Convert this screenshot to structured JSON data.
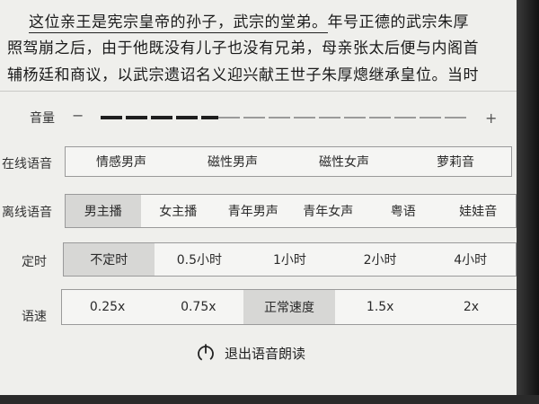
{
  "reading_text": {
    "line1_underlined": "这位亲王是宪宗皇帝的孙子，武宗的堂弟。",
    "line1_rest": "年号正德的武宗朱厚",
    "line2": "照驾崩之后，由于他既没有儿子也没有兄弟，母亲张太后便与内阁首",
    "line3": "辅杨廷和商议，以武宗遗诏名义迎兴献王世子朱厚熜继承皇位。当时"
  },
  "volume": {
    "label": "音量",
    "minus": "−",
    "plus": "+",
    "level": 0.32
  },
  "online_voice": {
    "label": "在线语音",
    "options": [
      "情感男声",
      "磁性男声",
      "磁性女声",
      "萝莉音"
    ],
    "selected_index": -1
  },
  "offline_voice": {
    "label": "离线语音",
    "options": [
      "男主播",
      "女主播",
      "青年男声",
      "青年女声",
      "粤语",
      "娃娃音"
    ],
    "selected_index": 0
  },
  "timer": {
    "label": "定时",
    "options": [
      "不定时",
      "0.5小时",
      "1小时",
      "2小时",
      "4小时"
    ],
    "selected_index": 0
  },
  "speed": {
    "label": "语速",
    "options": [
      "0.25x",
      "0.75x",
      "正常速度",
      "1.5x",
      "2x"
    ],
    "selected_index": 2
  },
  "exit": {
    "label": "退出语音朗读",
    "icon": "power-icon"
  }
}
